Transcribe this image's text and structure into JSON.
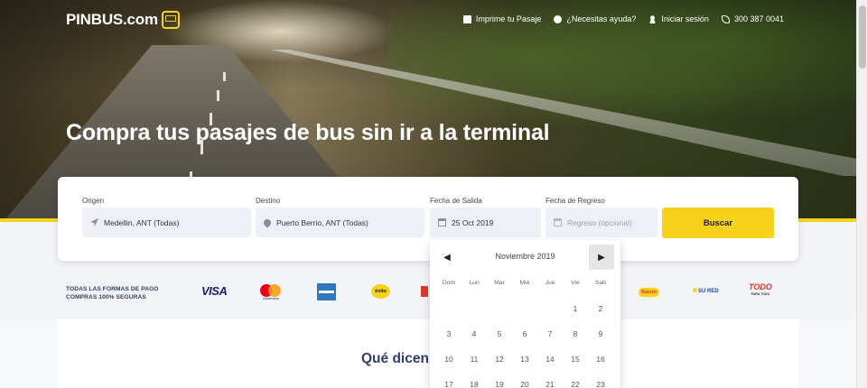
{
  "header": {
    "logo_text": "PINBUS.com",
    "nav": [
      {
        "icon": "print-icon",
        "label": "Imprime tu Pasaje"
      },
      {
        "icon": "help-icon",
        "label": "¿Necesitas ayuda?"
      },
      {
        "icon": "user-icon",
        "label": "Iniciar sesión"
      },
      {
        "icon": "phone-icon",
        "label": "300 387 0041"
      }
    ]
  },
  "hero": {
    "headline": "Compra tus pasajes de bus sin ir a la terminal"
  },
  "search": {
    "origin": {
      "label": "Origen",
      "value": "Medellin, ANT (Todas)"
    },
    "destination": {
      "label": "Destino",
      "value": "Puerto Berrio, ANT (Todas)"
    },
    "departure": {
      "label": "Fecha de Salida",
      "value": "25 Oct 2019"
    },
    "return": {
      "label": "Fecha de Regreso",
      "placeholder": "Regreso (opcional)"
    },
    "button_label": "Buscar"
  },
  "payments": {
    "text_line1": "TODAS LAS FORMAS DE PAGO",
    "text_line2": "COMPRAS 100% SEGURAS",
    "visa": "VISA",
    "mastercard": "mastercard",
    "exito": "éxito",
    "baloto": "Baloto",
    "sured": "SU RED",
    "todo_main": "TODO",
    "todo_sub": "PARA TODO"
  },
  "section": {
    "title": "Qué dicen de nosotros"
  },
  "calendar": {
    "month": "Noviembre 2019",
    "prev_symbol": "◀",
    "next_symbol": "▶",
    "weekdays": [
      "Dom",
      "Lun",
      "Mar",
      "Mié",
      "Jue",
      "Vie",
      "Sab"
    ],
    "weeks": [
      [
        "",
        "",
        "",
        "",
        "",
        "1",
        "2"
      ],
      [
        "3",
        "4",
        "5",
        "6",
        "7",
        "8",
        "9"
      ],
      [
        "10",
        "11",
        "12",
        "13",
        "14",
        "15",
        "16"
      ],
      [
        "17",
        "18",
        "19",
        "20",
        "21",
        "22",
        "23"
      ]
    ]
  },
  "colors": {
    "accent_yellow": "#f7d21a",
    "navy": "#2f3f69",
    "field_bg": "#eef0f8"
  }
}
